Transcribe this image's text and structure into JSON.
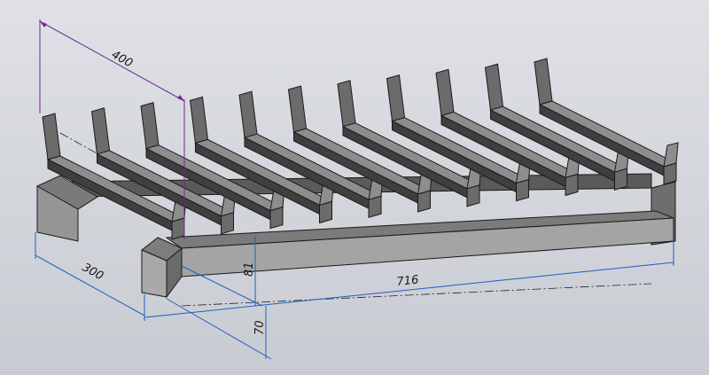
{
  "scene": {
    "model": "fireplace-grate",
    "bar_count": 11,
    "colors": {
      "background_top": "#dfe1e7",
      "background_bottom": "#c9cbd2",
      "metal_light": "#8d8d8d",
      "metal_mid": "#6b6b6b",
      "metal_dark": "#3f3f3f",
      "edge": "#1a1a1a",
      "dim_blue": "#1e5fbf",
      "dim_purple": "#6a2c8c"
    }
  },
  "dimensions": {
    "depth": "400",
    "width_front": "300",
    "length": "716",
    "height_bar": "81",
    "height_base": "70"
  }
}
